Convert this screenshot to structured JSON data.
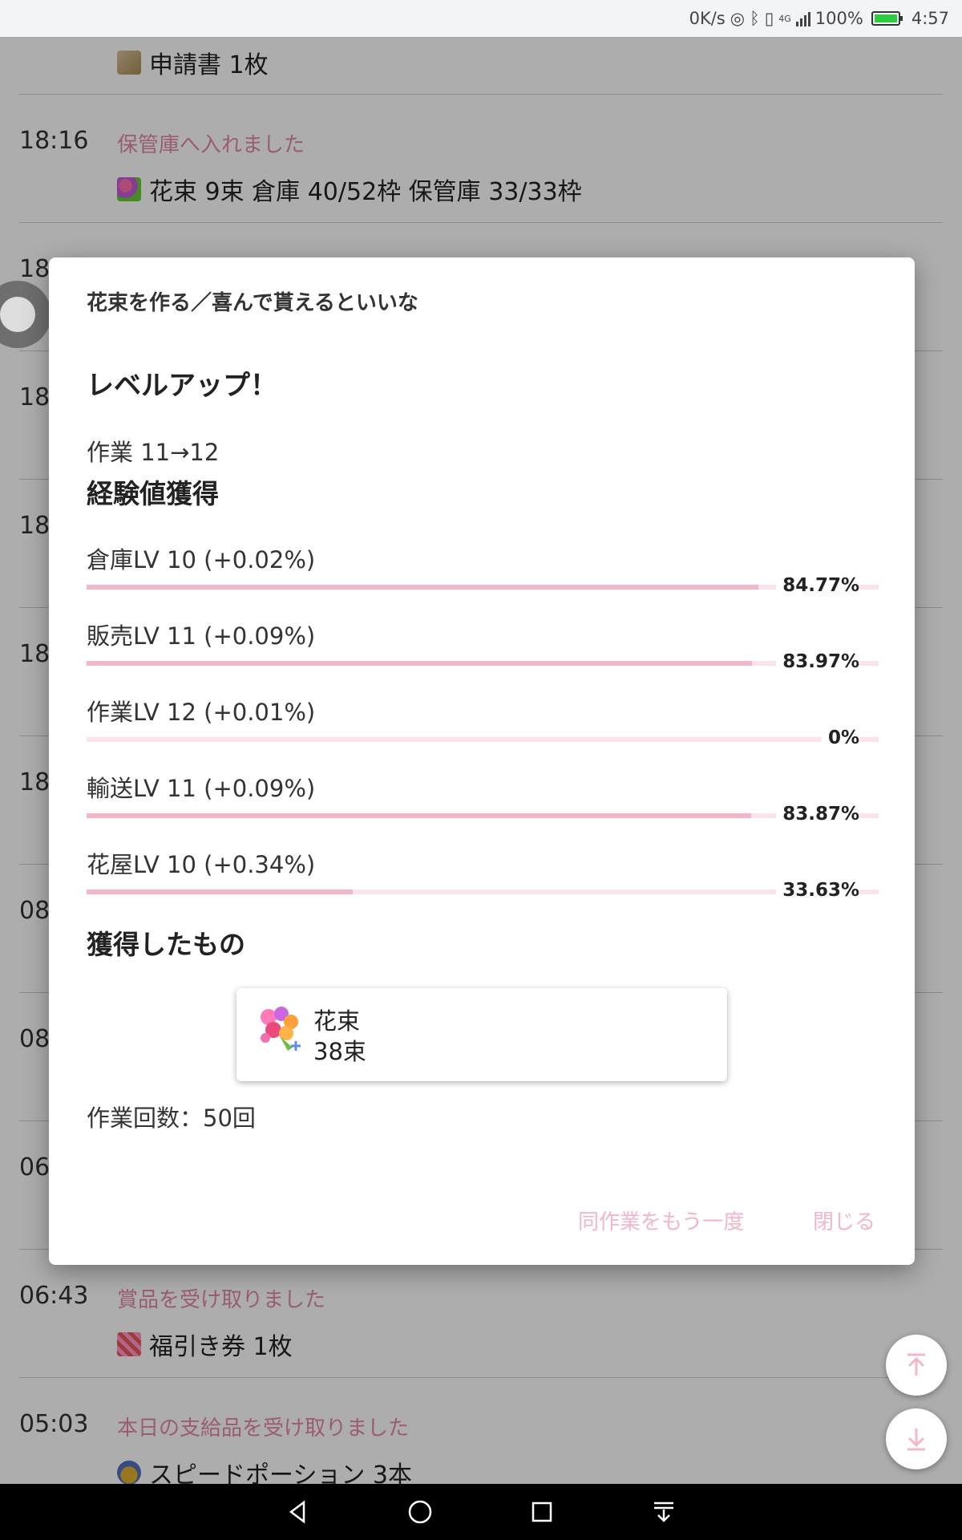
{
  "status_bar": {
    "speed": "0K/s",
    "network": "4G",
    "battery": "100%",
    "time": "4:57"
  },
  "log": {
    "entries": [
      {
        "time": "",
        "message": "",
        "item": "申請書 1枚",
        "icon": "scroll-icon"
      },
      {
        "time": "18:16",
        "message": "保管庫へ入れました",
        "item": "花束 9束 倉庫 40/52枠 保管庫 33/33枠",
        "icon": "bouquet-icon"
      },
      {
        "time": "18",
        "message": "",
        "item": "",
        "icon": ""
      },
      {
        "time": "18",
        "message": "",
        "item": "",
        "icon": ""
      },
      {
        "time": "18",
        "message": "",
        "item": "",
        "icon": ""
      },
      {
        "time": "18",
        "message": "",
        "item": "",
        "icon": ""
      },
      {
        "time": "18",
        "message": "",
        "item": "",
        "icon": ""
      },
      {
        "time": "08",
        "message": "",
        "item": "",
        "icon": ""
      },
      {
        "time": "08",
        "message": "",
        "item": "",
        "icon": ""
      },
      {
        "time": "06",
        "message": "",
        "item": "",
        "icon": ""
      },
      {
        "time": "06:43",
        "message": "賞品を受け取りました",
        "item": "福引き券 1枚",
        "icon": "ticket-icon"
      },
      {
        "time": "05:03",
        "message": "本日の支給品を受け取りました",
        "item": "スピードポーション 3本",
        "icon": "potion-icon"
      }
    ]
  },
  "dialog": {
    "title": "花束を作る／喜んで貰えるといいな",
    "level_up": "レベルアップ！",
    "level_change": "作業 11→12",
    "exp_heading": "経験値獲得",
    "skills": [
      {
        "label": "倉庫LV 10 (+0.02%)",
        "percent_text": "84.77%",
        "progress": 0.8477
      },
      {
        "label": "販売LV 11 (+0.09%)",
        "percent_text": "83.97%",
        "progress": 0.8397
      },
      {
        "label": "作業LV 12 (+0.01%)",
        "percent_text": "0%",
        "progress": 0.0
      },
      {
        "label": "輸送LV 11 (+0.09%)",
        "percent_text": "83.87%",
        "progress": 0.8387
      },
      {
        "label": "花屋LV 10 (+0.34%)",
        "percent_text": "33.63%",
        "progress": 0.3363
      }
    ],
    "obtained_heading": "獲得したもの",
    "obtained_item": {
      "name": "花束",
      "quantity": "38束",
      "icon": "bouquet-icon"
    },
    "work_count": "作業回数：50回",
    "repeat_button": "同作業をもう一度",
    "close_button": "閉じる"
  },
  "colors": {
    "accent_pink": "#f2b6c6",
    "progress_fill": "#f3b8c8",
    "progress_track": "#fbe3ea",
    "log_message": "#e48aa6"
  }
}
